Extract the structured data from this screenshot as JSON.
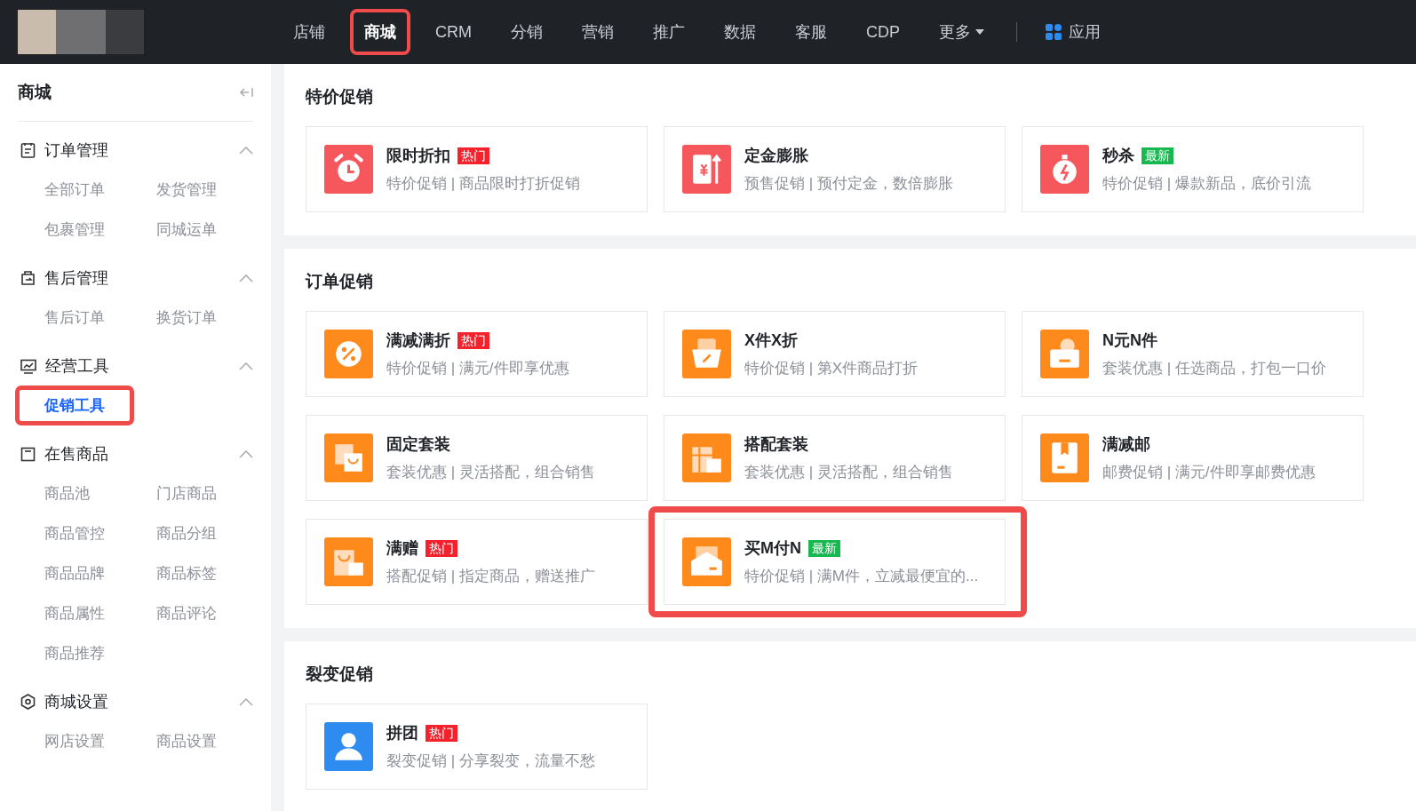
{
  "nav": {
    "items": [
      {
        "label": "店铺",
        "selected": false,
        "highlighted": false
      },
      {
        "label": "商城",
        "selected": true,
        "highlighted": true
      },
      {
        "label": "CRM",
        "selected": false,
        "highlighted": false
      },
      {
        "label": "分销",
        "selected": false,
        "highlighted": false
      },
      {
        "label": "营销",
        "selected": false,
        "highlighted": false
      },
      {
        "label": "推广",
        "selected": false,
        "highlighted": false
      },
      {
        "label": "数据",
        "selected": false,
        "highlighted": false
      },
      {
        "label": "客服",
        "selected": false,
        "highlighted": false
      },
      {
        "label": "CDP",
        "selected": false,
        "highlighted": false
      }
    ],
    "more": {
      "label": "更多"
    },
    "apps": {
      "label": "应用"
    }
  },
  "sidebar": {
    "title": "商城",
    "groups": [
      {
        "label": "订单管理",
        "expanded": true,
        "items": [
          {
            "label": "全部订单",
            "selected": false,
            "highlighted": false
          },
          {
            "label": "发货管理",
            "selected": false,
            "highlighted": false
          },
          {
            "label": "包裹管理",
            "selected": false,
            "highlighted": false
          },
          {
            "label": "同城运单",
            "selected": false,
            "highlighted": false
          }
        ]
      },
      {
        "label": "售后管理",
        "expanded": true,
        "items": [
          {
            "label": "售后订单",
            "selected": false,
            "highlighted": false
          },
          {
            "label": "换货订单",
            "selected": false,
            "highlighted": false
          }
        ]
      },
      {
        "label": "经营工具",
        "expanded": true,
        "items": [
          {
            "label": "促销工具",
            "selected": true,
            "highlighted": true
          }
        ]
      },
      {
        "label": "在售商品",
        "expanded": true,
        "items": [
          {
            "label": "商品池",
            "selected": false,
            "highlighted": false
          },
          {
            "label": "门店商品",
            "selected": false,
            "highlighted": false
          },
          {
            "label": "商品管控",
            "selected": false,
            "highlighted": false
          },
          {
            "label": "商品分组",
            "selected": false,
            "highlighted": false
          },
          {
            "label": "商品品牌",
            "selected": false,
            "highlighted": false
          },
          {
            "label": "商品标签",
            "selected": false,
            "highlighted": false
          },
          {
            "label": "商品属性",
            "selected": false,
            "highlighted": false
          },
          {
            "label": "商品评论",
            "selected": false,
            "highlighted": false
          },
          {
            "label": "商品推荐",
            "selected": false,
            "highlighted": false
          }
        ]
      },
      {
        "label": "商城设置",
        "expanded": true,
        "items": [
          {
            "label": "网店设置",
            "selected": false,
            "highlighted": false
          },
          {
            "label": "商品设置",
            "selected": false,
            "highlighted": false
          }
        ]
      }
    ]
  },
  "sections": [
    {
      "title": "特价促销",
      "cards": [
        {
          "title": "限时折扣",
          "tag": {
            "text": "热门",
            "kind": "hot"
          },
          "description": "特价促销 | 商品限时打折促销",
          "color": "#f5575c",
          "highlighted": false
        },
        {
          "title": "定金膨胀",
          "description": "预售促销 | 预付定金，数倍膨胀",
          "color": "#f5575c",
          "highlighted": false
        },
        {
          "title": "秒杀",
          "tag": {
            "text": "最新",
            "kind": "new"
          },
          "description": "特价促销 | 爆款新品，底价引流",
          "color": "#f5575c",
          "highlighted": false
        }
      ]
    },
    {
      "title": "订单促销",
      "cards": [
        {
          "title": "满减满折",
          "tag": {
            "text": "热门",
            "kind": "hot"
          },
          "description": "特价促销 | 满元/件即享优惠",
          "color": "#ff8a1c",
          "highlighted": false
        },
        {
          "title": "X件X折",
          "description": "特价促销 | 第X件商品打折",
          "color": "#ff8a1c",
          "highlighted": false
        },
        {
          "title": "N元N件",
          "description": "套装优惠 | 任选商品，打包一口价",
          "color": "#ff8a1c",
          "highlighted": false
        },
        {
          "title": "固定套装",
          "description": "套装优惠 | 灵活搭配，组合销售",
          "color": "#ff8a1c",
          "highlighted": false
        },
        {
          "title": "搭配套装",
          "description": "套装优惠 | 灵活搭配，组合销售",
          "color": "#ff8a1c",
          "highlighted": false
        },
        {
          "title": "满减邮",
          "description": "邮费促销 | 满元/件即享邮费优惠",
          "color": "#ff8a1c",
          "highlighted": false
        },
        {
          "title": "满赠",
          "tag": {
            "text": "热门",
            "kind": "hot"
          },
          "description": "搭配促销 | 指定商品，赠送推广",
          "color": "#ff8a1c",
          "highlighted": false
        },
        {
          "title": "买M付N",
          "tag": {
            "text": "最新",
            "kind": "new"
          },
          "description": "特价促销 | 满M件，立减最便宜的...",
          "color": "#ff8a1c",
          "highlighted": true
        }
      ]
    },
    {
      "title": "裂变促销",
      "cards": [
        {
          "title": "拼团",
          "tag": {
            "text": "热门",
            "kind": "hot"
          },
          "description": "裂变促销 | 分享裂变，流量不愁",
          "color": "#2e8cf0",
          "highlighted": false
        }
      ]
    }
  ]
}
